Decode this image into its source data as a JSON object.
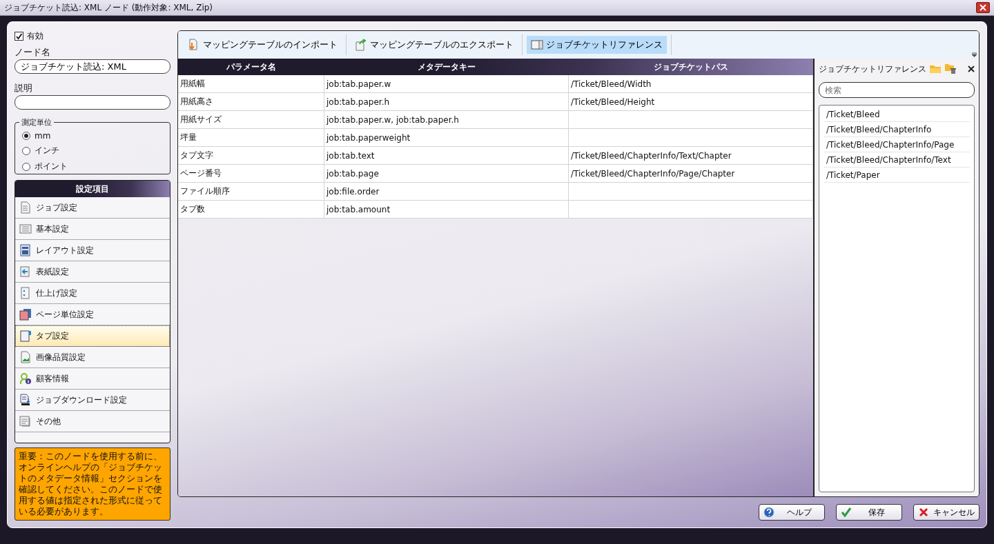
{
  "window": {
    "title": "ジョブチケット読込: XML ノード (動作対象: XML, Zip)"
  },
  "enabled": {
    "label": "有効",
    "checked": true
  },
  "node_name": {
    "label": "ノード名",
    "value": "ジョブチケット読込: XML"
  },
  "description": {
    "label": "説明"
  },
  "unit": {
    "title": "測定単位",
    "options": [
      {
        "label": "mm",
        "selected": true
      },
      {
        "label": "インチ",
        "selected": false
      },
      {
        "label": "ポイント",
        "selected": false
      }
    ]
  },
  "settings": {
    "title": "設定項目",
    "items": [
      {
        "label": "ジョブ設定",
        "selected": false
      },
      {
        "label": "基本設定",
        "selected": false
      },
      {
        "label": "レイアウト設定",
        "selected": false
      },
      {
        "label": "表紙設定",
        "selected": false
      },
      {
        "label": "仕上げ設定",
        "selected": false
      },
      {
        "label": "ページ単位設定",
        "selected": false
      },
      {
        "label": "タブ設定",
        "selected": true
      },
      {
        "label": "画像品質設定",
        "selected": false
      },
      {
        "label": "顧客情報",
        "selected": false
      },
      {
        "label": "ジョブダウンロード設定",
        "selected": false
      },
      {
        "label": "その他",
        "selected": false
      }
    ]
  },
  "notice": "重要：このノードを使用する前に、オンラインヘルプの「ジョブチケットのメタデータ情報」セクションを確認してください。このノードで使用する値は指定された形式に従っている必要があります。",
  "toolbar": [
    {
      "label": "マッピングテーブルのインポート",
      "kind": "import",
      "selected": false
    },
    {
      "label": "マッピングテーブルのエクスポート",
      "kind": "export",
      "selected": false
    },
    {
      "label": "ジョブチケットリファレンス",
      "kind": "reference",
      "selected": true
    }
  ],
  "table": {
    "columns": [
      "パラメータ名",
      "メタデータキー",
      "ジョブチケットパス"
    ],
    "rows": [
      {
        "parameter": "用紙幅",
        "key": "job:tab.paper.w",
        "path": "/Ticket/Bleed/Width"
      },
      {
        "parameter": "用紙高さ",
        "key": "job:tab.paper.h",
        "path": "/Ticket/Bleed/Height"
      },
      {
        "parameter": "用紙サイズ",
        "key": "job:tab.paper.w, job:tab.paper.h"
      },
      {
        "parameter": "坪量",
        "key": "job:tab.paperweight"
      },
      {
        "parameter": "タブ文字",
        "key": "job:tab.text",
        "path": "/Ticket/Bleed/ChapterInfo/Text/Chapter"
      },
      {
        "parameter": "ページ番号",
        "key": "job:tab.page",
        "path": "/Ticket/Bleed/ChapterInfo/Page/Chapter"
      },
      {
        "parameter": "ファイル順序",
        "key": "job:file.order"
      },
      {
        "parameter": "タブ数",
        "key": "job:tab.amount"
      }
    ]
  },
  "reference": {
    "title": "ジョブチケットリファレンス",
    "search": {
      "placeholder": "検索"
    },
    "items": [
      "/Ticket/Bleed",
      "/Ticket/Bleed/ChapterInfo",
      "/Ticket/Bleed/ChapterInfo/Page",
      "/Ticket/Bleed/ChapterInfo/Text",
      "/Ticket/Paper"
    ]
  },
  "buttons": [
    {
      "label": "ヘルプ",
      "kind": "help"
    },
    {
      "label": "保存",
      "kind": "save"
    },
    {
      "label": "キャンセル",
      "kind": "cancel"
    }
  ]
}
